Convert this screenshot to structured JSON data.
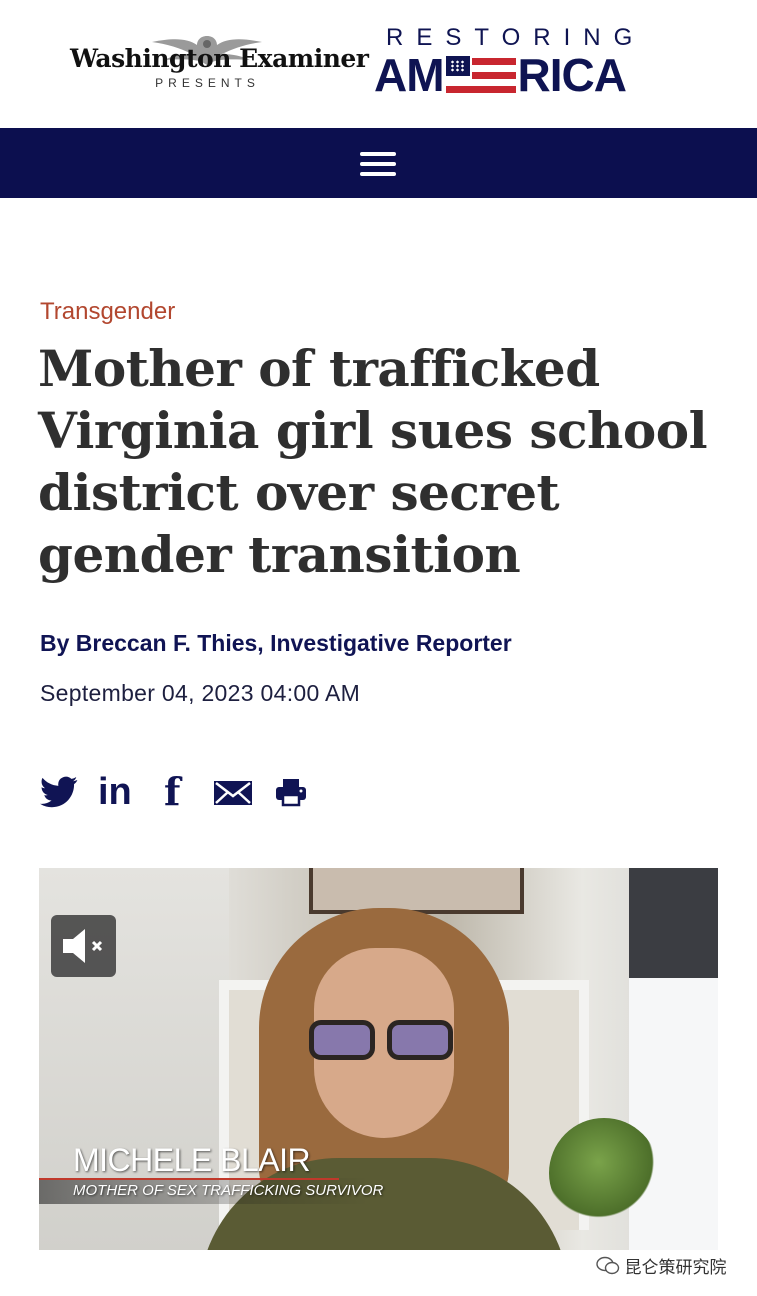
{
  "header": {
    "publisher_name": "Washington Examiner",
    "presents": "PRESENTS",
    "section_brand_top": "RESTORING",
    "section_brand_bottom_left": "AM",
    "section_brand_bottom_right": "RICA",
    "brand_color": "#0c0f4f",
    "accent_color": "#c8262f"
  },
  "nav": {
    "menu_icon": "hamburger-menu-icon"
  },
  "article": {
    "category": "Transgender",
    "headline": "Mother of trafficked Virginia girl sues school district over secret gender transition",
    "byline": "By Breccan F. Thies, Investigative Reporter",
    "date": "September 04, 2023 04:00 AM"
  },
  "share": {
    "icons": [
      "twitter-icon",
      "linkedin-icon",
      "facebook-icon",
      "email-icon",
      "print-icon"
    ],
    "linkedin_glyph": "in",
    "facebook_glyph": "f"
  },
  "video": {
    "muted": true,
    "lower_third_name": "MICHELE BLAIR",
    "lower_third_title": "MOTHER OF SEX TRAFFICKING SURVIVOR"
  },
  "watermark": {
    "text": "昆仑策研究院"
  }
}
